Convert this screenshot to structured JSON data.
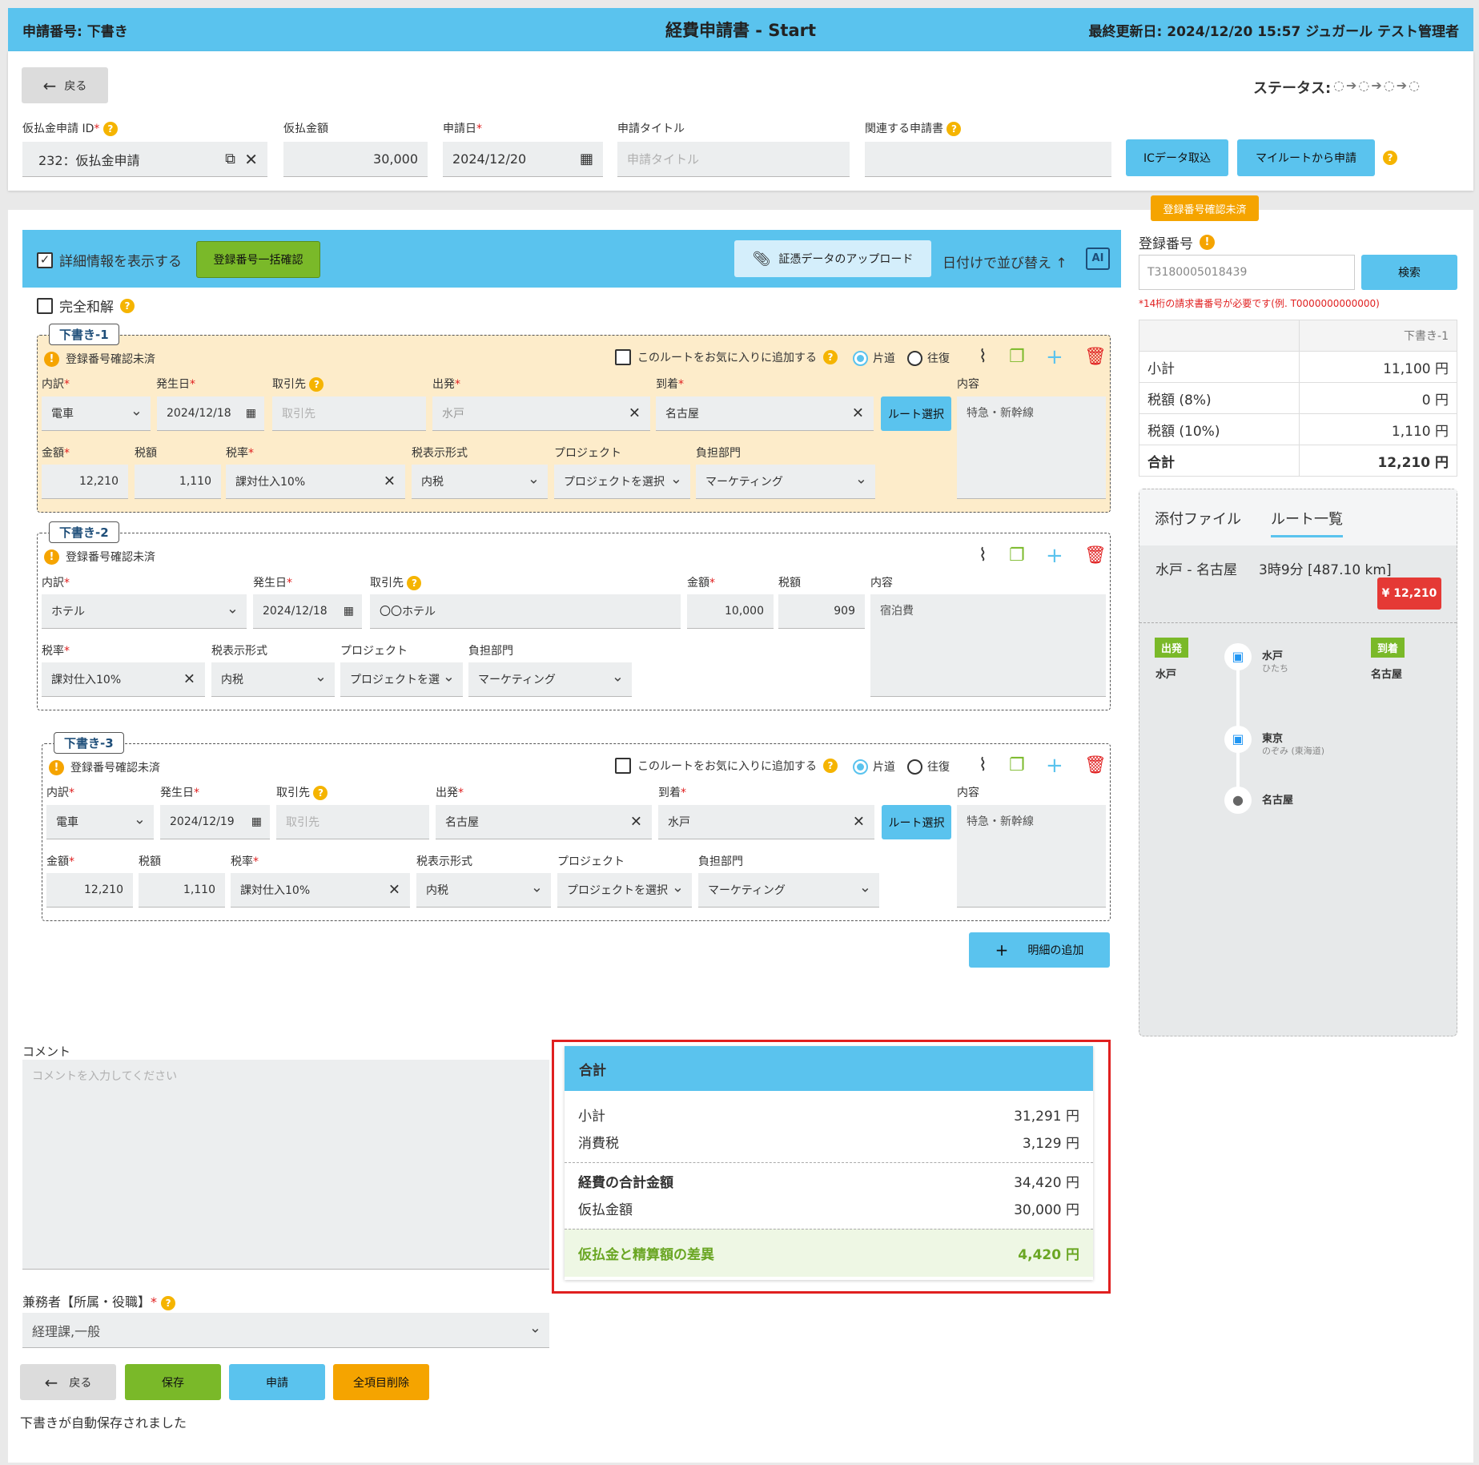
{
  "header": {
    "app_no": "申請番号: 下書き",
    "title": "経費申請書 - Start",
    "updated": "最終更新日: 2024/12/20 15:57 ジュガール テスト管理者"
  },
  "top": {
    "back": "戻る",
    "status_label": "ステータス:",
    "prepay_id_label": "仮払金申請 ID",
    "prepay_id_value": "232：仮払金申請",
    "prepay_amount_label": "仮払金額",
    "prepay_amount_value": "30,000",
    "date_label": "申請日",
    "date_value": "2024/12/20",
    "title_label": "申請タイトル",
    "title_placeholder": "申請タイトル",
    "related_label": "関連する申請書",
    "ic_button": "ICデータ取込",
    "myroute_button": "マイルートから申請"
  },
  "toolbar": {
    "show_detail": "詳細情報を表示する",
    "bulk_check": "登録番号一括確認",
    "upload": "証憑データのアップロード",
    "sort": "日付けで並び替え",
    "full_settle": "完全和解"
  },
  "labels": {
    "uchiwake": "内訳",
    "date": "発生日",
    "vendor": "取引先",
    "vendor_ph": "取引先",
    "dep": "出発",
    "arr": "到着",
    "route_btn": "ルート選択",
    "content": "内容",
    "amount": "金額",
    "tax": "税額",
    "rate": "税率",
    "tax_fmt": "税表示形式",
    "project": "プロジェクト",
    "dept": "負担部門",
    "fav": "このルートをお気に入りに追加する",
    "oneway": "片道",
    "round": "往復",
    "warn": "登録番号確認未済"
  },
  "entries": [
    {
      "tag": "下書き-1",
      "type": "電車",
      "date": "2024/12/18",
      "dep": "水戸",
      "arr": "名古屋",
      "content": "特急・新幹線",
      "amount": "12,210",
      "tax": "1,110",
      "rate": "課対仕入10%",
      "fmt": "内税",
      "project": "プロジェクトを選択",
      "dept": "マーケティング"
    },
    {
      "tag": "下書き-2",
      "type": "ホテル",
      "date": "2024/12/18",
      "vendor": "〇〇ホテル",
      "amount": "10,000",
      "tax": "909",
      "content": "宿泊費",
      "rate": "課対仕入10%",
      "fmt": "内税",
      "project": "プロジェクトを選",
      "dept": "マーケティング"
    },
    {
      "tag": "下書き-3",
      "type": "電車",
      "date": "2024/12/19",
      "dep": "名古屋",
      "arr": "水戸",
      "content": "特急・新幹線",
      "amount": "12,210",
      "tax": "1,110",
      "rate": "課対仕入10%",
      "fmt": "内税",
      "project": "プロジェクトを選択",
      "dept": "マーケティング"
    }
  ],
  "add_detail": "明細の追加",
  "side": {
    "badge": "登録番号確認未済",
    "reg_label": "登録番号",
    "reg_value": "T3180005018439",
    "search": "検索",
    "hint": "*14桁の請求書番号が必要です(例. T0000000000000)",
    "col": "下書き-1",
    "rows": [
      [
        "小計",
        "11,100 円"
      ],
      [
        "税額 (8%)",
        "0 円"
      ],
      [
        "税額 (10%)",
        "1,110 円"
      ],
      [
        "合計",
        "12,210 円"
      ]
    ],
    "tab1": "添付ファイル",
    "tab2": "ルート一覧",
    "route": "水戸 - 名古屋",
    "route_time": "3時9分 [487.10 km]",
    "price": "¥ 12,210",
    "dep_pill": "出発",
    "dep_name": "水戸",
    "arr_pill": "到着",
    "arr_name": "名古屋",
    "stops": [
      {
        "name": "水戸",
        "sub": "ひたち"
      },
      {
        "name": "東京",
        "sub": "のぞみ (東海道)"
      },
      {
        "name": "名古屋",
        "sub": ""
      }
    ]
  },
  "comment": {
    "label": "コメント",
    "placeholder": "コメントを入力してください"
  },
  "totals": {
    "title": "合計",
    "subtotal_l": "小計",
    "subtotal": "31,291 円",
    "tax_l": "消費税",
    "tax": "3,129 円",
    "sum_l": "経費の合計金額",
    "sum": "34,420 円",
    "prepay_l": "仮払金額",
    "prepay": "30,000 円",
    "diff_l": "仮払金と精算額の差異",
    "diff": "4,420 円"
  },
  "duty": {
    "label": "兼務者【所属・役職】",
    "value": "経理課,一般"
  },
  "bottom": {
    "back": "戻る",
    "save": "保存",
    "apply": "申請",
    "clear": "全項目削除",
    "saved_msg": "下書きが自動保存されました"
  }
}
